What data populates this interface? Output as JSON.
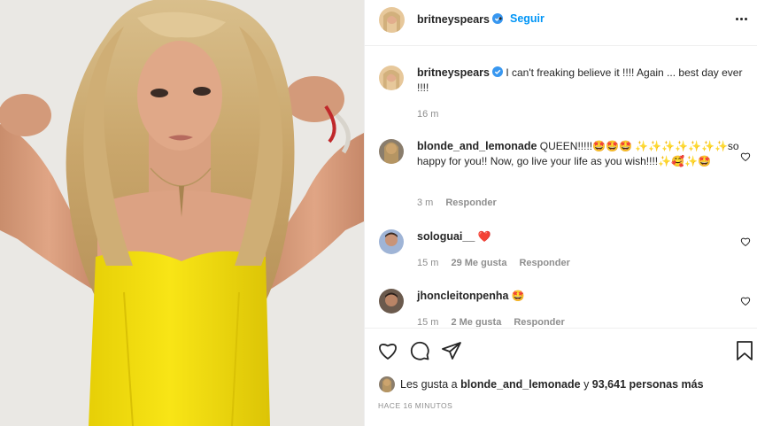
{
  "post": {
    "username": "britneyspears",
    "follow_label": "Seguir",
    "separator": "•",
    "caption": "I can't freaking believe it !!!! Again ... best day ever !!!!",
    "caption_time": "16 m"
  },
  "comments": [
    {
      "username": "blonde_and_lemonade",
      "text": "QUEEN!!!!!🤩🤩🤩 ✨✨✨✨✨✨✨so happy for you!! Now, go live your life as you wish!!!!✨🥰✨🤩",
      "time": "3 m",
      "likes": "",
      "reply": "Responder"
    },
    {
      "username": "sologuai__",
      "text": "❤️",
      "time": "15 m",
      "likes": "29 Me gusta",
      "reply": "Responder"
    },
    {
      "username": "jhoncleitonpenha",
      "text": "🤩",
      "time": "15 m",
      "likes": "2 Me gusta",
      "reply": "Responder"
    }
  ],
  "likes": {
    "prefix": "Les gusta a",
    "user": "blonde_and_lemonade",
    "middle": "y",
    "count": "93,641 personas más"
  },
  "timestamp": "HACE 16 MINUTOS",
  "icons": [
    "verified-icon",
    "more-options-icon",
    "like-heart-icon",
    "comment-icon",
    "share-icon",
    "bookmark-icon",
    "comment-like-icon"
  ],
  "colors": {
    "link": "#0095f6",
    "verified": "#3897f0",
    "dress": "#f5e20f",
    "muted": "#8e8e8e"
  }
}
